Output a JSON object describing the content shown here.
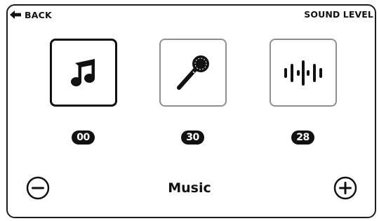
{
  "header": {
    "back_label": "BACK",
    "title": "SOUND LEVEL"
  },
  "sources": [
    {
      "name": "Music",
      "icon": "music-note-icon",
      "level": "00",
      "selected": true
    },
    {
      "name": "Microphone",
      "icon": "microphone-icon",
      "level": "30",
      "selected": false
    },
    {
      "name": "Sound wave",
      "icon": "sound-wave-icon",
      "level": "28",
      "selected": false
    }
  ],
  "controls": {
    "selected_name": "Music",
    "decrease_icon": "minus-circle-icon",
    "increase_icon": "plus-circle-icon"
  },
  "colors": {
    "foreground": "#111111",
    "unselected_border": "#8f8f8f",
    "background": "#ffffff"
  }
}
